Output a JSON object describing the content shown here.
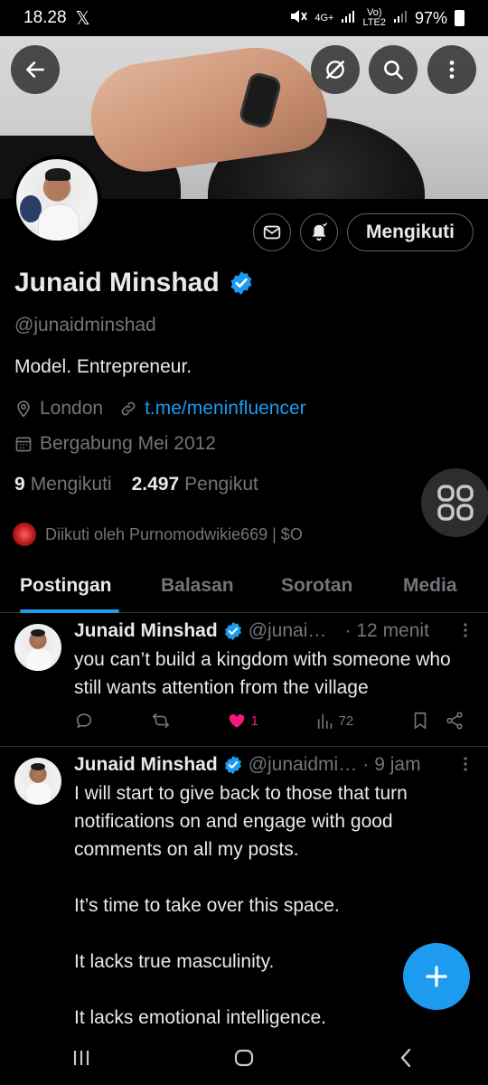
{
  "status_bar": {
    "time": "18.28",
    "x_logo": "𝕏",
    "network_4g": "4G+",
    "volte": "Vo)",
    "lte2": "LTE2",
    "battery": "97%"
  },
  "profile": {
    "display_name": "Junaid Minshad",
    "handle": "@junaidminshad",
    "bio": "Model. Entrepreneur.",
    "location": "London",
    "website": "t.me/meninfluencer",
    "joined": "Bergabung Mei 2012",
    "following_count": "9",
    "following_label": "Mengikuti",
    "followers_count": "2.497",
    "followers_label": "Pengikut",
    "followed_by": "Diikuti oleh Purnomodwikie669 | $O",
    "follow_button": "Mengikuti"
  },
  "tabs": [
    {
      "label": "Postingan",
      "active": true
    },
    {
      "label": "Balasan",
      "active": false
    },
    {
      "label": "Sorotan",
      "active": false
    },
    {
      "label": "Media",
      "active": false
    }
  ],
  "posts": [
    {
      "name": "Junaid Minshad",
      "handle": "@junai…",
      "dot": "·",
      "time": "12 menit",
      "text": "you can’t build a kingdom with someone who still wants attention from the village",
      "likes": "1",
      "views": "72"
    },
    {
      "name": "Junaid Minshad",
      "handle": "@junaidmi…",
      "dot": "·",
      "time": "9 jam",
      "text": "I will start to give back to those that turn notifications on and engage with good comments on all my posts.\n\nIt’s time to take over this space.\n\nIt lacks true masculinity.\n\nIt lacks emotional intelligence."
    }
  ],
  "colors": {
    "accent": "#1d9bf0",
    "like": "#f91880",
    "muted": "#71767b",
    "border": "#2f3336"
  },
  "icons": [
    "back-arrow-icon",
    "grok-icon",
    "search-icon",
    "more-vertical-icon",
    "mail-icon",
    "bell-icon",
    "verified-icon",
    "location-icon",
    "link-icon",
    "calendar-icon",
    "grid-icon",
    "reply-icon",
    "retweet-icon",
    "heart-icon",
    "views-icon",
    "bookmark-icon",
    "share-icon",
    "plus-icon"
  ]
}
